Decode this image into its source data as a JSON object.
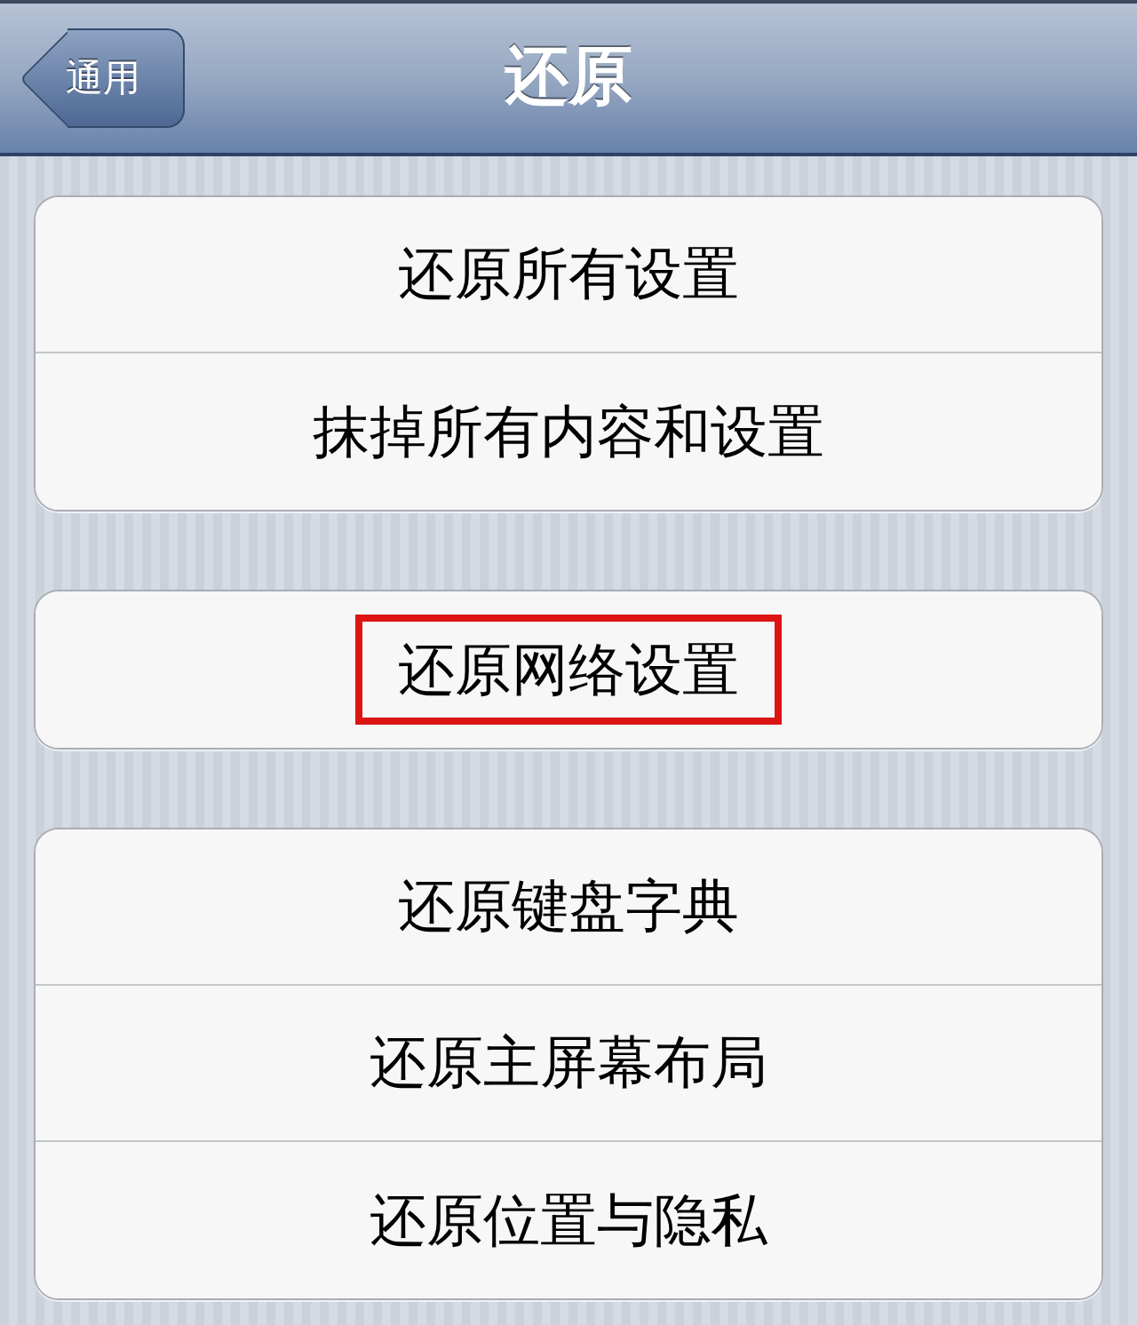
{
  "nav_bar": {
    "back_button": "通用",
    "title": "还原"
  },
  "groups": [
    {
      "items": [
        {
          "label": "还原所有设置",
          "highlighted": false
        },
        {
          "label": "抹掉所有内容和设置",
          "highlighted": false
        }
      ]
    },
    {
      "items": [
        {
          "label": "还原网络设置",
          "highlighted": true
        }
      ]
    },
    {
      "items": [
        {
          "label": "还原键盘字典",
          "highlighted": false
        },
        {
          "label": "还原主屏幕布局",
          "highlighted": false
        },
        {
          "label": "还原位置与隐私",
          "highlighted": false
        }
      ]
    }
  ]
}
